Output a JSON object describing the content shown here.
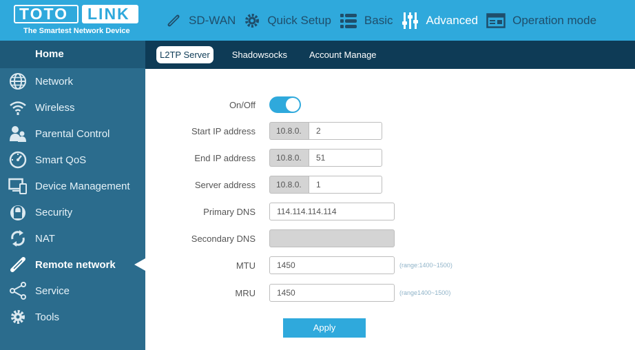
{
  "brand": {
    "logo_left": "TOTO",
    "logo_right": "LINK",
    "tagline": "The Smartest Network Device",
    "accent": "#2fa9dc",
    "sidebar_bg": "#2b6c8d",
    "subtab_bg": "#0e3b56"
  },
  "topnav": [
    {
      "label": "SD-WAN",
      "icon": "link-icon"
    },
    {
      "label": "Quick Setup",
      "icon": "gear-icon"
    },
    {
      "label": "Basic",
      "icon": "list-icon"
    },
    {
      "label": "Advanced",
      "icon": "sliders-icon",
      "active": true
    },
    {
      "label": "Operation mode",
      "icon": "window-icon"
    }
  ],
  "sidebar": {
    "home": "Home",
    "items": [
      {
        "label": "Network",
        "icon": "globe-icon"
      },
      {
        "label": "Wireless",
        "icon": "wifi-icon"
      },
      {
        "label": "Parental Control",
        "icon": "parental-icon"
      },
      {
        "label": "Smart QoS",
        "icon": "gauge-icon"
      },
      {
        "label": "Device Management",
        "icon": "devices-icon"
      },
      {
        "label": "Security",
        "icon": "lock-icon"
      },
      {
        "label": "NAT",
        "icon": "refresh-icon"
      },
      {
        "label": "Remote network",
        "icon": "link-icon",
        "active": true
      },
      {
        "label": "Service",
        "icon": "share-icon"
      },
      {
        "label": "Tools",
        "icon": "tools-gear-icon"
      }
    ]
  },
  "subtabs": [
    "L2TP Server",
    "Shadowsocks",
    "Account Manage"
  ],
  "form": {
    "onoff_label": "On/Off",
    "onoff_state": "on",
    "start_ip": {
      "label": "Start IP address",
      "prefix": "10.8.0.",
      "value": "2"
    },
    "end_ip": {
      "label": "End IP address",
      "prefix": "10.8.0.",
      "value": "51"
    },
    "server_addr": {
      "label": "Server address",
      "prefix": "10.8.0.",
      "value": "1"
    },
    "primary_dns": {
      "label": "Primary DNS",
      "value": "114.114.114.114"
    },
    "secondary_dns": {
      "label": "Secondary DNS",
      "value": ""
    },
    "mtu": {
      "label": "MTU",
      "value": "1450",
      "hint": "(range:1400~1500)"
    },
    "mru": {
      "label": "MRU",
      "value": "1450",
      "hint": "(range1400~1500)"
    },
    "apply": "Apply"
  }
}
